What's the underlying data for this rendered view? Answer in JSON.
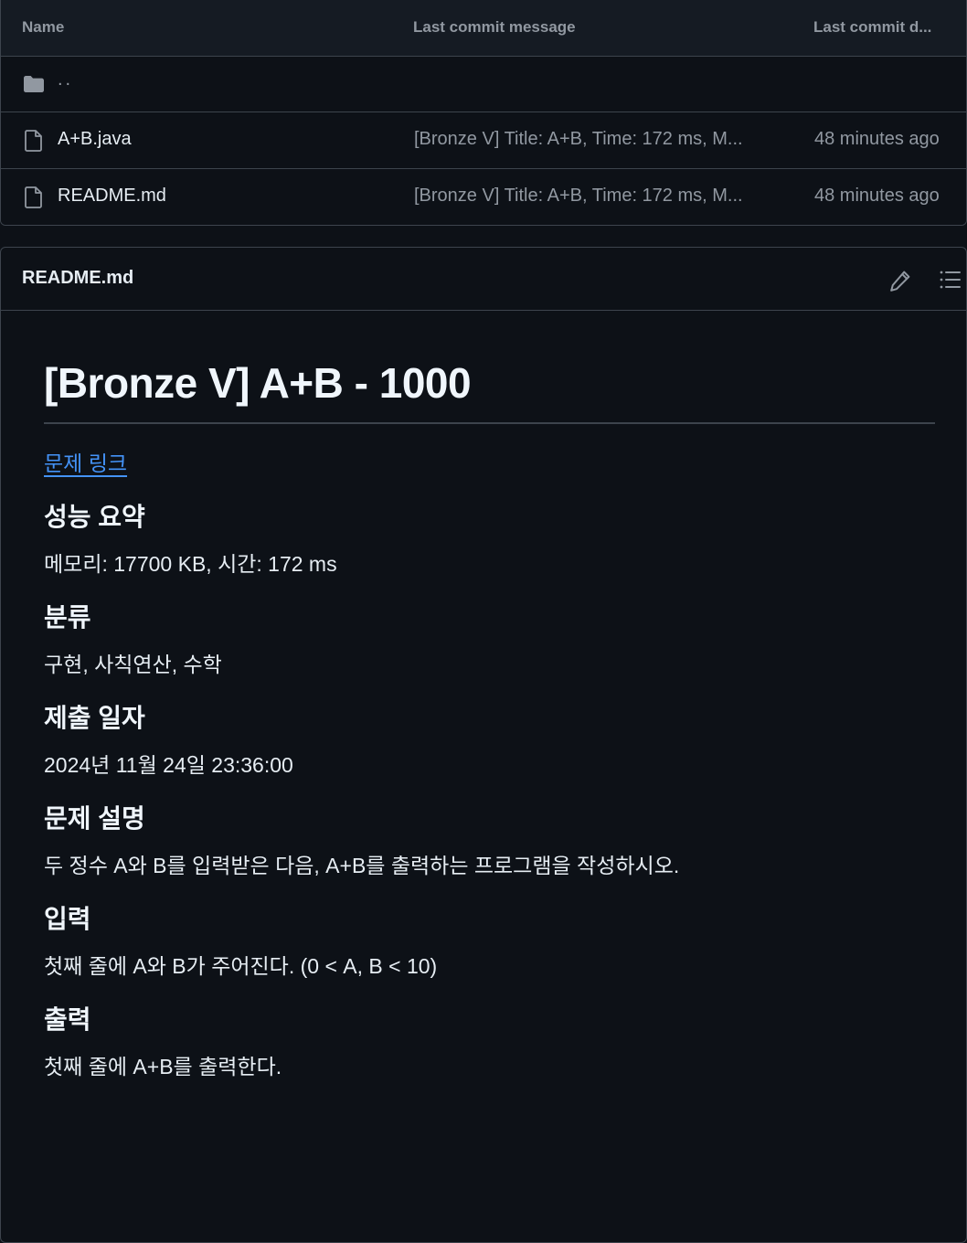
{
  "file_table": {
    "headers": {
      "name": "Name",
      "message": "Last commit message",
      "date": "Last commit d..."
    },
    "parent_dir": "..",
    "rows": [
      {
        "name": "A+B.java",
        "message": "[Bronze V] Title: A+B, Time: 172 ms, M...",
        "date": "48 minutes ago",
        "icon": "file-icon"
      },
      {
        "name": "README.md",
        "message": "[Bronze V] Title: A+B, Time: 172 ms, M...",
        "date": "48 minutes ago",
        "icon": "file-icon"
      }
    ]
  },
  "readme": {
    "filename": "README.md",
    "heading": "[Bronze V] A+B - 1000",
    "link_text": "문제 링크",
    "sections": [
      {
        "title": "성능 요약",
        "body": "메모리: 17700 KB, 시간: 172 ms"
      },
      {
        "title": "분류",
        "body": "구현, 사칙연산, 수학"
      },
      {
        "title": "제출 일자",
        "body": "2024년 11월 24일 23:36:00"
      },
      {
        "title": "문제 설명",
        "body": "두 정수 A와 B를 입력받은 다음, A+B를 출력하는 프로그램을 작성하시오."
      },
      {
        "title": "입력",
        "body": "첫째 줄에 A와 B가 주어진다. (0 < A, B < 10)"
      },
      {
        "title": "출력",
        "body": "첫째 줄에 A+B를 출력한다."
      }
    ]
  },
  "colors": {
    "background": "#0d1117",
    "header_bg": "#151b23",
    "border": "#3d444d",
    "muted_text": "#9198a1",
    "link": "#4493f8"
  }
}
